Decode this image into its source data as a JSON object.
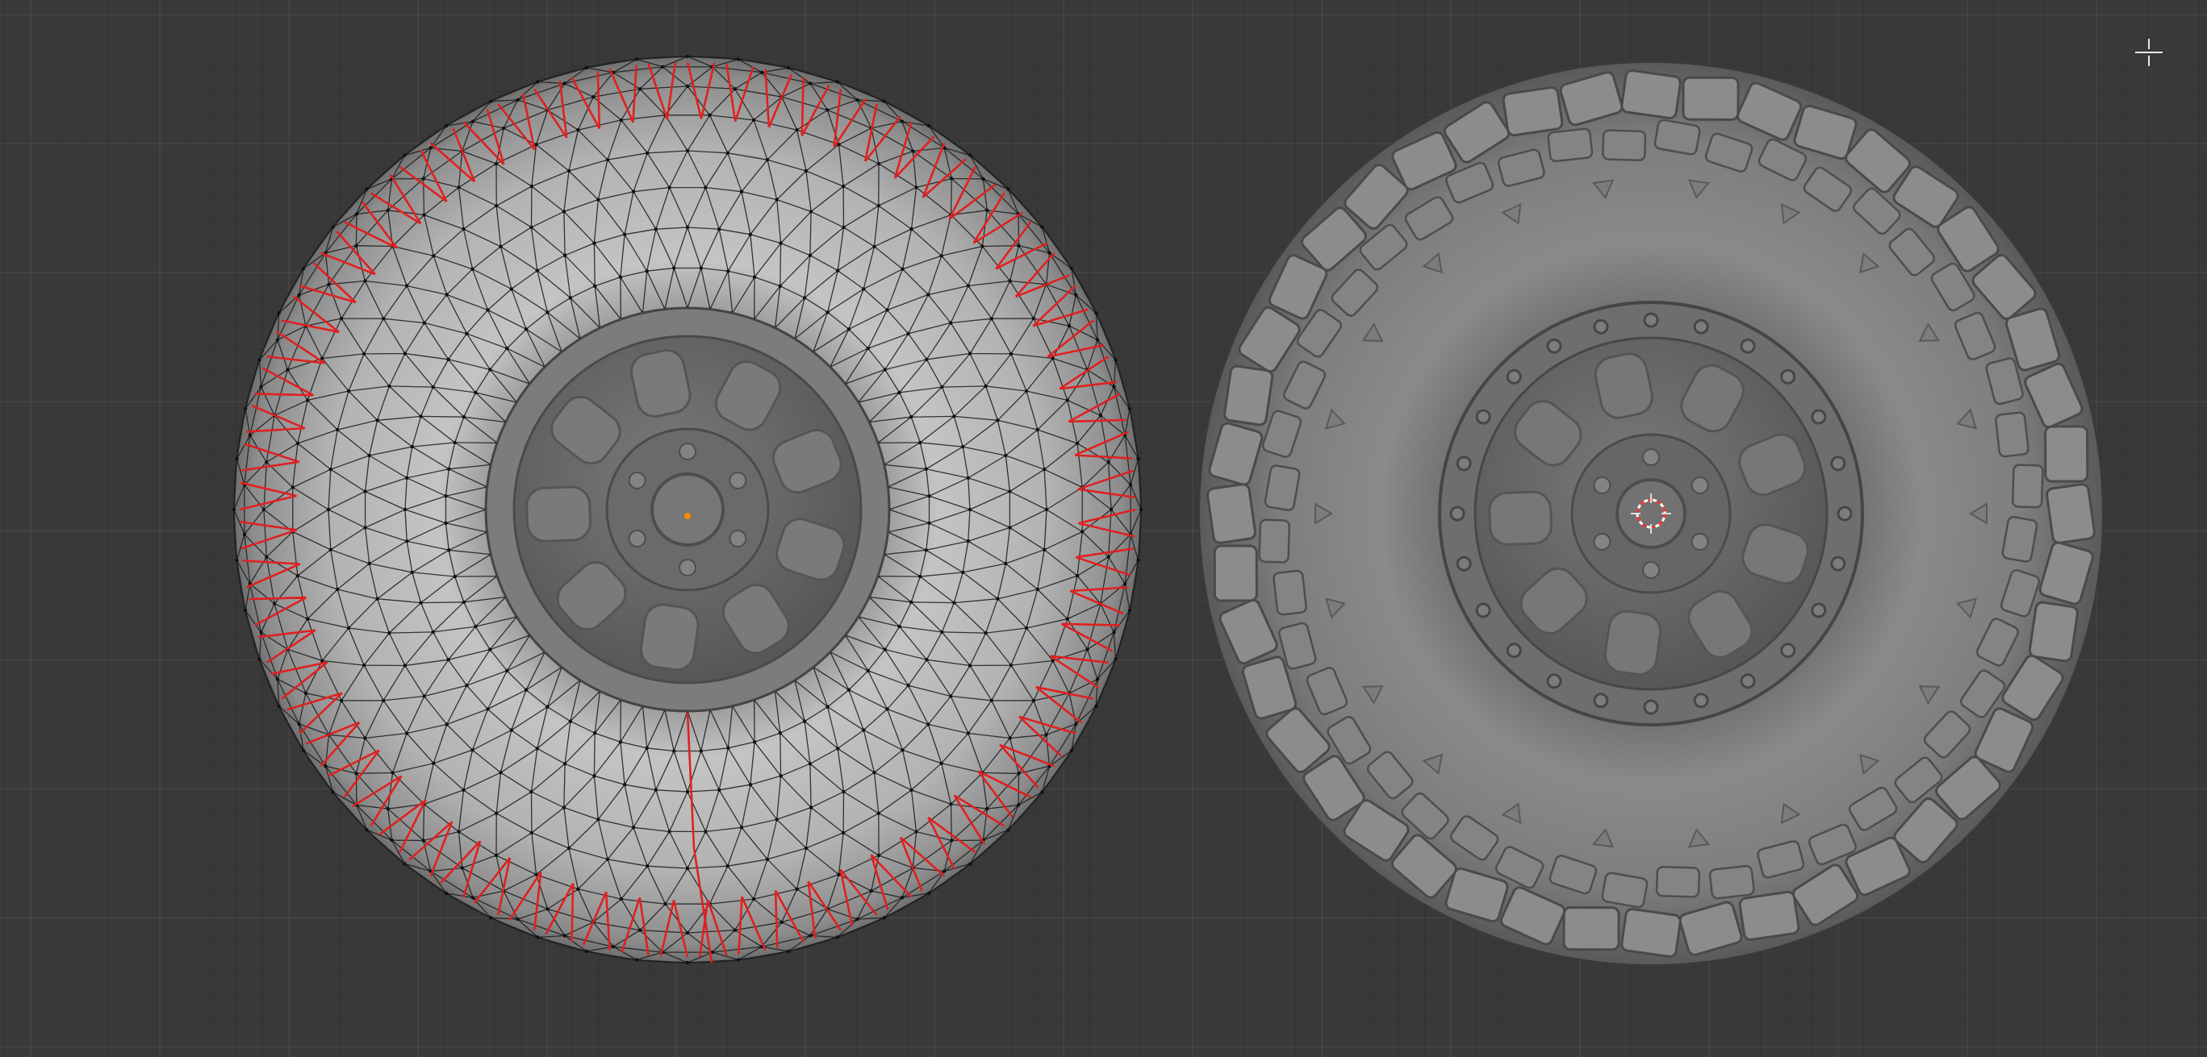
{
  "viewport": {
    "background_color": "#393939",
    "grid_color": "#444444"
  },
  "objects": [
    {
      "name": "wheel-low-poly-wireframe",
      "shading": "solid-wireframe",
      "mesh_color": "#b4b4b4",
      "wire_color": "#1a1a1a",
      "seam_color": "#e02020"
    },
    {
      "name": "wheel-high-poly-sculpt",
      "shading": "solid",
      "mesh_color": "#8a8a8a"
    }
  ],
  "overlays": {
    "origin_color": "#ff8a00",
    "cursor_3d_colors": [
      "#ff3030",
      "#ffffff"
    ],
    "navigate_icon": "crosshair-icon"
  }
}
